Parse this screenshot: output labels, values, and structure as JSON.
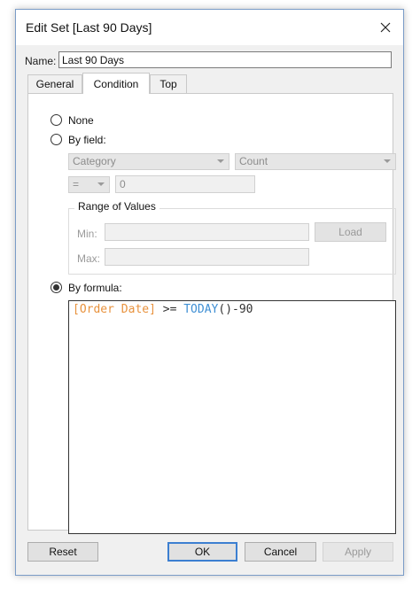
{
  "window": {
    "title": "Edit Set [Last 90 Days]"
  },
  "name": {
    "label": "Name:",
    "value": "Last 90 Days"
  },
  "tabs": [
    {
      "label": "General",
      "active": false
    },
    {
      "label": "Condition",
      "active": true
    },
    {
      "label": "Top",
      "active": false
    }
  ],
  "condition": {
    "none_label": "None",
    "by_field_label": "By field:",
    "field_dropdown": "Category",
    "aggregation_dropdown": "Count",
    "operator_dropdown": "=",
    "value": "0",
    "range": {
      "title": "Range of Values",
      "min_label": "Min:",
      "max_label": "Max:",
      "load_label": "Load"
    },
    "by_formula_label": "By formula:",
    "formula": {
      "field": "[Order Date]",
      "operator": " >= ",
      "function": "TODAY",
      "rest": "()-90"
    },
    "selected": "by_formula"
  },
  "buttons": {
    "reset": "Reset",
    "ok": "OK",
    "cancel": "Cancel",
    "apply": "Apply"
  },
  "colors": {
    "field": "#e8923d",
    "function": "#3f8fd4",
    "focus": "#3c7fd1"
  }
}
